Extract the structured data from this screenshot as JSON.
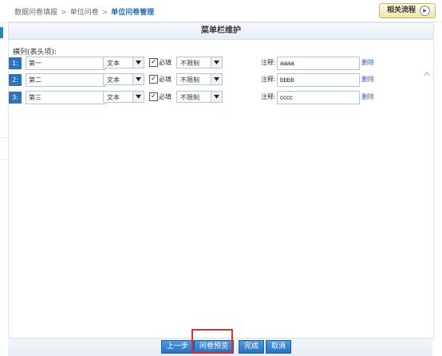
{
  "breadcrumb": {
    "items": [
      "数据问卷填报",
      "单位问卷",
      "单位问卷管理"
    ],
    "separator": ">"
  },
  "related_flow_button": {
    "label": "相关流程",
    "icon": "circle-arrow-right-icon"
  },
  "panel": {
    "title": "菜单栏维护",
    "group_label": "横列(表头项):"
  },
  "rows": [
    {
      "num": "1:",
      "name": "第一",
      "type": "文本",
      "required_checked": true,
      "required_label": "必填",
      "limit": "不限制",
      "note_label": "注释:",
      "note": "aaaa",
      "delete_label": "删除"
    },
    {
      "num": "2:",
      "name": "第二",
      "type": "文本",
      "required_checked": true,
      "required_label": "必填",
      "limit": "不限制",
      "note_label": "注释:",
      "note": "bbbb",
      "delete_label": "删除"
    },
    {
      "num": "3:",
      "name": "第三",
      "type": "文本",
      "required_checked": true,
      "required_label": "必填",
      "limit": "不限制",
      "note_label": "注释:",
      "note": "cccc",
      "delete_label": "删除"
    }
  ],
  "footer": {
    "prev_label": "上一步",
    "preview_label": "问卷预览",
    "finish_label": "完成",
    "cancel_label": "取消"
  },
  "colors": {
    "accent": "#2f73bd",
    "highlight": "#e03131",
    "link": "#3a5fa8"
  }
}
